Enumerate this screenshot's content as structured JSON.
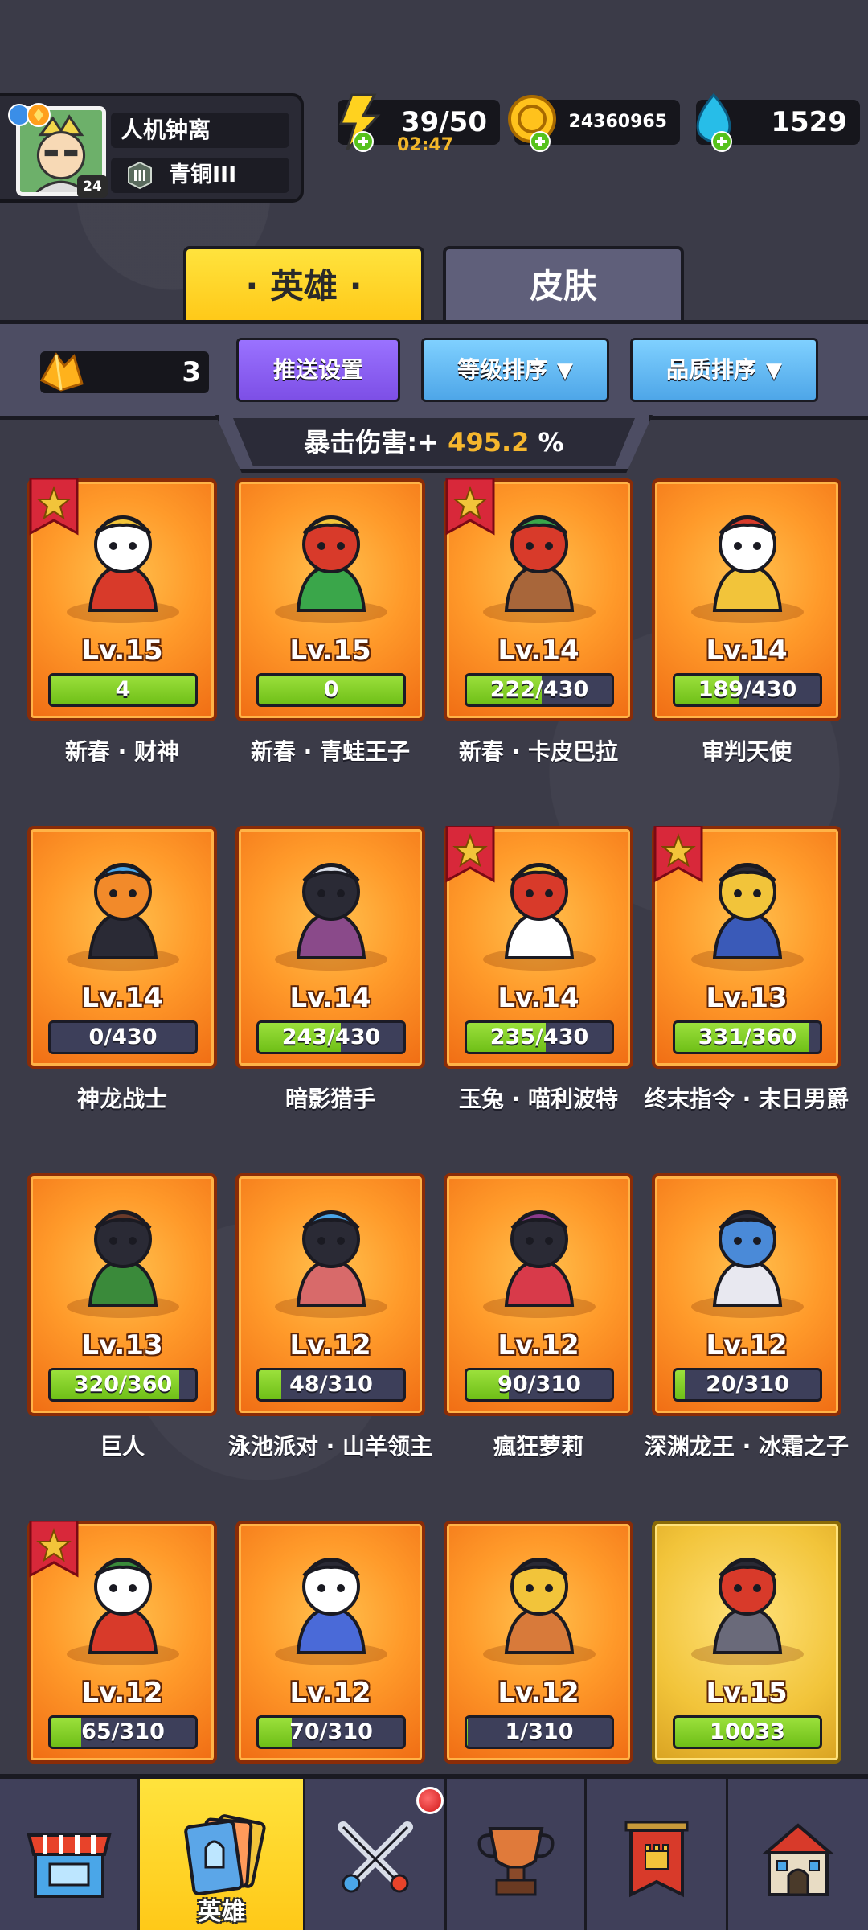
{
  "profile": {
    "name": "人机钟离",
    "level": "24",
    "rank": "青铜III"
  },
  "resources": {
    "energy": "39/50",
    "energy_timer": "02:47",
    "gold": "24360965",
    "gems": "1529"
  },
  "tabs": {
    "heroes": "· 英雄 ·",
    "skins": "皮肤"
  },
  "toolbar": {
    "shards": "3",
    "push_settings": "推送设置",
    "level_sort": "等级排序",
    "quality_sort": "品质排序"
  },
  "crit": {
    "label": "暴击伤害:+",
    "value": "495.2",
    "unit": "%"
  },
  "heroes": [
    {
      "name": "新春 · 财神",
      "level": "Lv.15",
      "progress": "4",
      "fill": 1.0,
      "flag": true
    },
    {
      "name": "新春 · 青蛙王子",
      "level": "Lv.15",
      "progress": "0",
      "fill": 1.0,
      "flag": false
    },
    {
      "name": "新春 · 卡皮巴拉",
      "level": "Lv.14",
      "progress": "222/430",
      "fill": 0.516,
      "flag": true
    },
    {
      "name": "审判天使",
      "level": "Lv.14",
      "progress": "189/430",
      "fill": 0.44,
      "flag": false
    },
    {
      "name": "神龙战士",
      "level": "Lv.14",
      "progress": "0/430",
      "fill": 0.0,
      "flag": false
    },
    {
      "name": "暗影猎手",
      "level": "Lv.14",
      "progress": "243/430",
      "fill": 0.565,
      "flag": false
    },
    {
      "name": "玉兔 · 喵利波特",
      "level": "Lv.14",
      "progress": "235/430",
      "fill": 0.547,
      "flag": true
    },
    {
      "name": "终末指令 · 末日男爵",
      "level": "Lv.13",
      "progress": "331/360",
      "fill": 0.92,
      "flag": true
    },
    {
      "name": "巨人",
      "level": "Lv.13",
      "progress": "320/360",
      "fill": 0.889,
      "flag": false
    },
    {
      "name": "泳池派对 · 山羊领主",
      "level": "Lv.12",
      "progress": "48/310",
      "fill": 0.155,
      "flag": false
    },
    {
      "name": "瘋狂萝莉",
      "level": "Lv.12",
      "progress": "90/310",
      "fill": 0.29,
      "flag": false
    },
    {
      "name": "深渊龙王 · 冰霜之子",
      "level": "Lv.12",
      "progress": "20/310",
      "fill": 0.065,
      "flag": false
    },
    {
      "name": "",
      "level": "Lv.12",
      "progress": "65/310",
      "fill": 0.21,
      "flag": true
    },
    {
      "name": "",
      "level": "Lv.12",
      "progress": "70/310",
      "fill": 0.226,
      "flag": false
    },
    {
      "name": "",
      "level": "Lv.12",
      "progress": "1/310",
      "fill": 0.003,
      "flag": false
    },
    {
      "name": "",
      "level": "Lv.15",
      "progress": "10033",
      "fill": 1.0,
      "flag": false,
      "gold": true
    }
  ],
  "nav": {
    "heroes_label": "英雄"
  }
}
